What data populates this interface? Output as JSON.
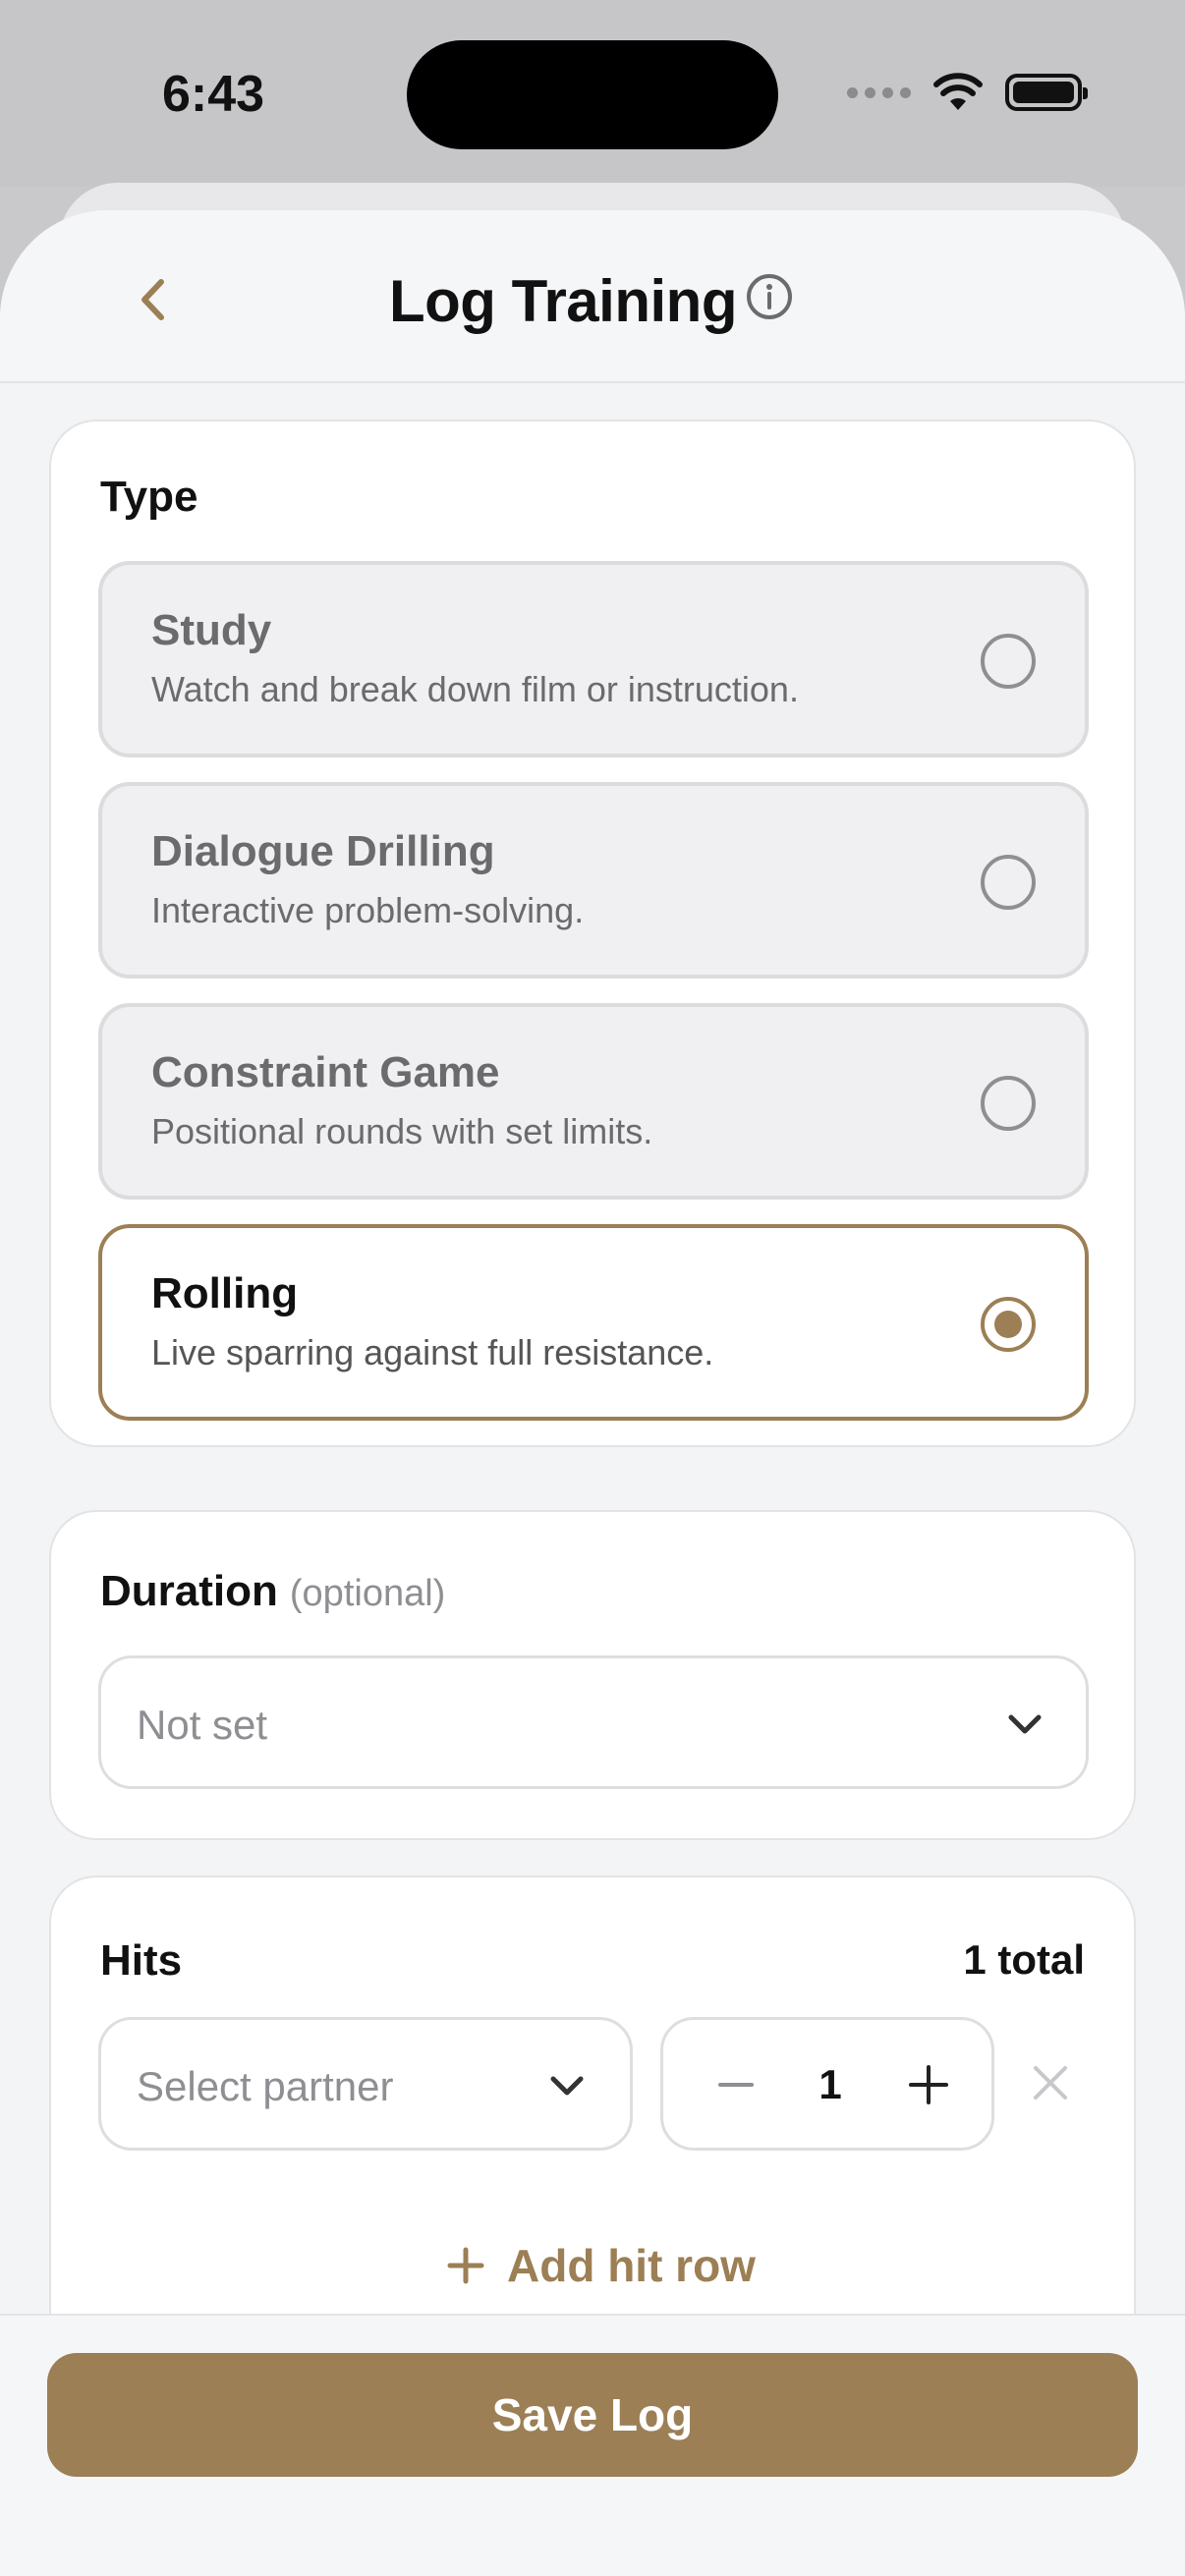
{
  "status_bar": {
    "time": "6:43"
  },
  "nav": {
    "title": "Log Training",
    "back_icon": "chevron-left-icon",
    "info_icon": "info-circle-icon"
  },
  "type_section": {
    "label": "Type",
    "options": [
      {
        "title": "Study",
        "description": "Watch and break down film or instruction.",
        "selected": false
      },
      {
        "title": "Dialogue Drilling",
        "description": "Interactive problem-solving.",
        "selected": false
      },
      {
        "title": "Constraint Game",
        "description": "Positional rounds with set limits.",
        "selected": false
      },
      {
        "title": "Rolling",
        "description": "Live sparring against full resistance.",
        "selected": true
      }
    ]
  },
  "duration_section": {
    "label": "Duration",
    "optional_note": "(optional)",
    "value": "Not set"
  },
  "hits_section": {
    "label": "Hits",
    "total": "1 total",
    "rows": [
      {
        "partner_placeholder": "Select partner",
        "count": "1"
      }
    ],
    "add_row_label": "Add hit row"
  },
  "footer": {
    "save_label": "Save Log"
  },
  "colors": {
    "accent": "#9c7f55",
    "background": "#f3f4f6",
    "card": "#ffffff"
  }
}
